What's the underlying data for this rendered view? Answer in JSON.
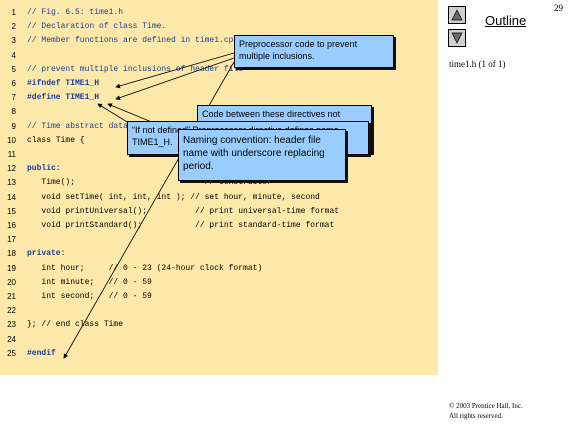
{
  "slide_number": "29",
  "outline": {
    "title": "Outline",
    "file_label": "time1.h (1 of 1)"
  },
  "copyright": {
    "line1": "© 2003 Prentice Hall, Inc.",
    "line2": "All rights reserved."
  },
  "code_lines": [
    {
      "num": "1",
      "text": "// Fig. 6.5: time1.h",
      "style": "comment"
    },
    {
      "num": "2",
      "text": "// Declaration of class Time.",
      "style": "comment"
    },
    {
      "num": "3",
      "text": "// Member functions are defined in time1.cpp",
      "style": "comment"
    },
    {
      "num": "4",
      "text": "",
      "style": "plain"
    },
    {
      "num": "5",
      "text": "// prevent multiple inclusions of header file",
      "style": "comment"
    },
    {
      "num": "6",
      "text": "#ifndef TIME1_H",
      "style": "keyword"
    },
    {
      "num": "7",
      "text": "#define TIME1_H",
      "style": "keyword"
    },
    {
      "num": "8",
      "text": "",
      "style": "plain"
    },
    {
      "num": "9",
      "text": "// Time abstract data type definition",
      "style": "comment"
    },
    {
      "num": "10",
      "text": "class Time {",
      "style": "plain"
    },
    {
      "num": "11",
      "text": "",
      "style": "plain"
    },
    {
      "num": "12",
      "text": "public:",
      "style": "keyword"
    },
    {
      "num": "13",
      "text": "   Time();                           // constructor",
      "style": "plain"
    },
    {
      "num": "14",
      "text": "   void setTime( int, int, int ); // set hour, minute, second",
      "style": "plain"
    },
    {
      "num": "15",
      "text": "   void printUniversal();          // print universal-time format",
      "style": "plain"
    },
    {
      "num": "16",
      "text": "   void printStandard();           // print standard-time format",
      "style": "plain"
    },
    {
      "num": "17",
      "text": "",
      "style": "plain"
    },
    {
      "num": "18",
      "text": "private:",
      "style": "keyword"
    },
    {
      "num": "19",
      "text": "   int hour;     // 0 - 23 (24-hour clock format)",
      "style": "plain"
    },
    {
      "num": "20",
      "text": "   int minute;   // 0 - 59",
      "style": "plain"
    },
    {
      "num": "21",
      "text": "   int second;   // 0 - 59",
      "style": "plain"
    },
    {
      "num": "22",
      "text": "",
      "style": "plain"
    },
    {
      "num": "23",
      "text": "}; // end class Time",
      "style": "plain"
    },
    {
      "num": "24",
      "text": "",
      "style": "plain"
    },
    {
      "num": "25",
      "text": "#endif",
      "style": "keyword"
    }
  ],
  "callouts": {
    "preprocessor": "Preprocessor code to prevent multiple inclusions.",
    "code_between": "Code between these directives not included if name TIME1_H already defined.",
    "if_not_defined": "“If not defined” Preprocessor directive defines name TIME1_H.",
    "naming": "Naming convention: header file name with underscore replacing period."
  },
  "colors": {
    "code_background": "#fce8a8",
    "callout": "#99ccff",
    "comment_text": "#1a3d99"
  },
  "icons": {
    "up": "triangle-up-icon",
    "down": "triangle-down-icon"
  }
}
